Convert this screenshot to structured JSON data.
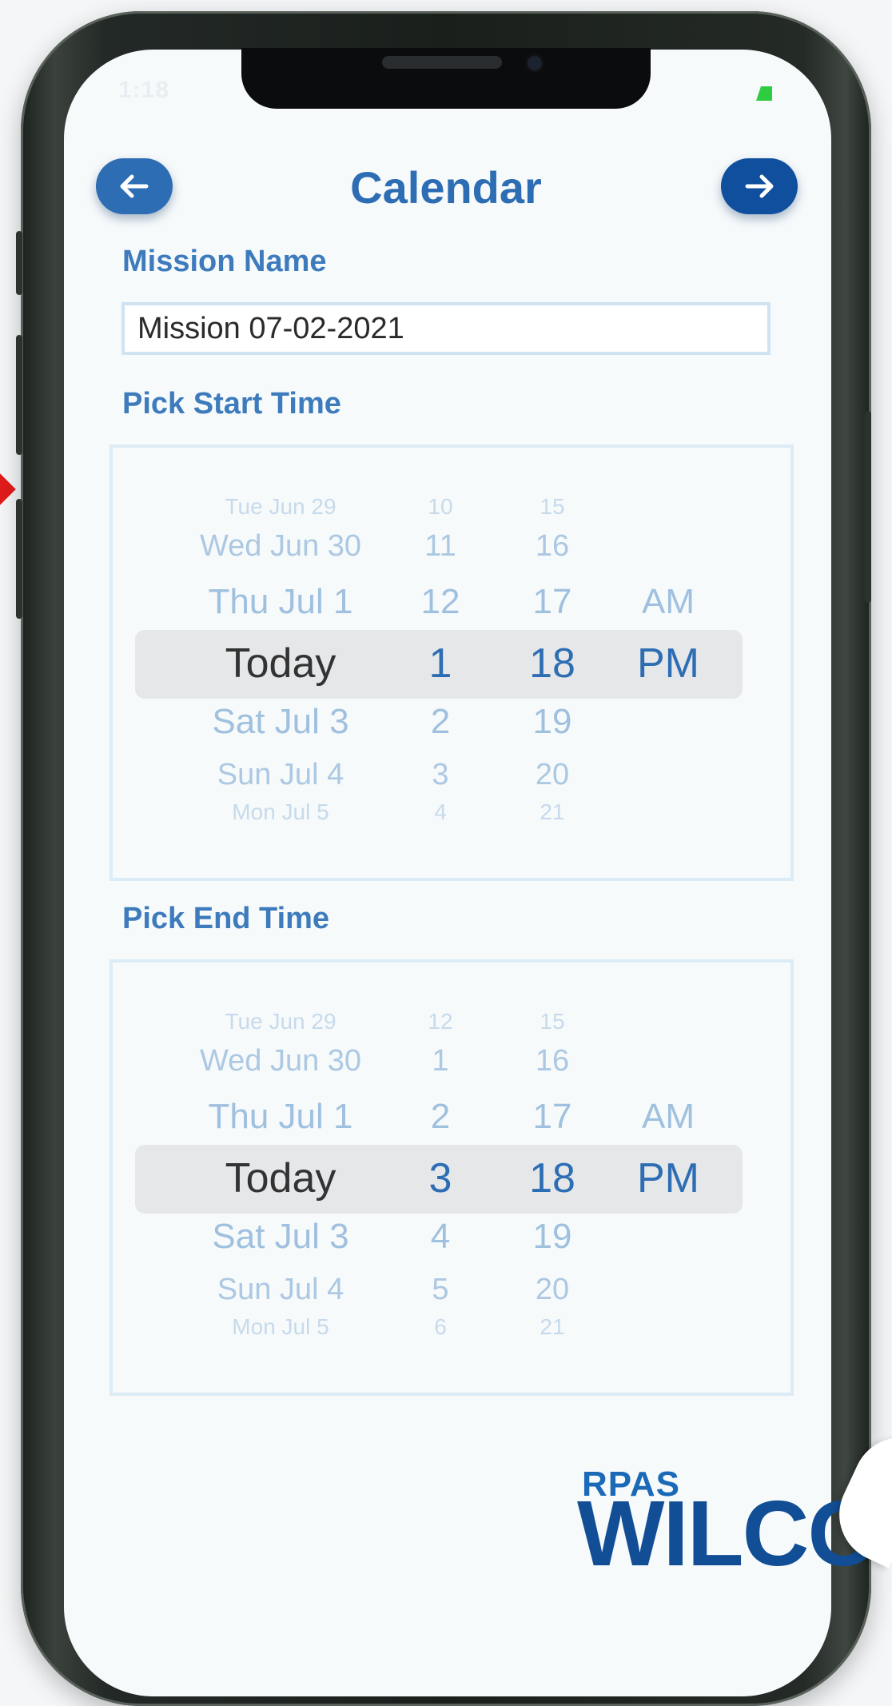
{
  "status": {
    "time": "1:18"
  },
  "header": {
    "title": "Calendar"
  },
  "mission": {
    "label": "Mission Name",
    "value": "Mission 07-02-2021"
  },
  "start_picker": {
    "label": "Pick Start Time",
    "rows": [
      {
        "day": "Tue Jun 29",
        "hour": "10",
        "minute": "15",
        "ampm": ""
      },
      {
        "day": "Wed Jun 30",
        "hour": "11",
        "minute": "16",
        "ampm": ""
      },
      {
        "day": "Thu Jul 1",
        "hour": "12",
        "minute": "17",
        "ampm": "AM"
      },
      {
        "day": "Today",
        "hour": "1",
        "minute": "18",
        "ampm": "PM"
      },
      {
        "day": "Sat Jul 3",
        "hour": "2",
        "minute": "19",
        "ampm": ""
      },
      {
        "day": "Sun Jul 4",
        "hour": "3",
        "minute": "20",
        "ampm": ""
      },
      {
        "day": "Mon Jul 5",
        "hour": "4",
        "minute": "21",
        "ampm": ""
      }
    ]
  },
  "end_picker": {
    "label": "Pick End Time",
    "rows": [
      {
        "day": "Tue Jun 29",
        "hour": "12",
        "minute": "15",
        "ampm": ""
      },
      {
        "day": "Wed Jun 30",
        "hour": "1",
        "minute": "16",
        "ampm": ""
      },
      {
        "day": "Thu Jul 1",
        "hour": "2",
        "minute": "17",
        "ampm": "AM"
      },
      {
        "day": "Today",
        "hour": "3",
        "minute": "18",
        "ampm": "PM"
      },
      {
        "day": "Sat Jul 3",
        "hour": "4",
        "minute": "19",
        "ampm": ""
      },
      {
        "day": "Sun Jul 4",
        "hour": "5",
        "minute": "20",
        "ampm": ""
      },
      {
        "day": "Mon Jul 5",
        "hour": "6",
        "minute": "21",
        "ampm": ""
      }
    ]
  },
  "logo": {
    "line1": "RPAS",
    "line2": "WILCO"
  },
  "icons": {
    "back": "arrow-left-icon",
    "forward": "arrow-right-icon",
    "battery": "battery-icon"
  },
  "colors": {
    "accent": "#2d6db3",
    "accent_dark": "#0f4f9e",
    "faded": "#9fc0de"
  }
}
